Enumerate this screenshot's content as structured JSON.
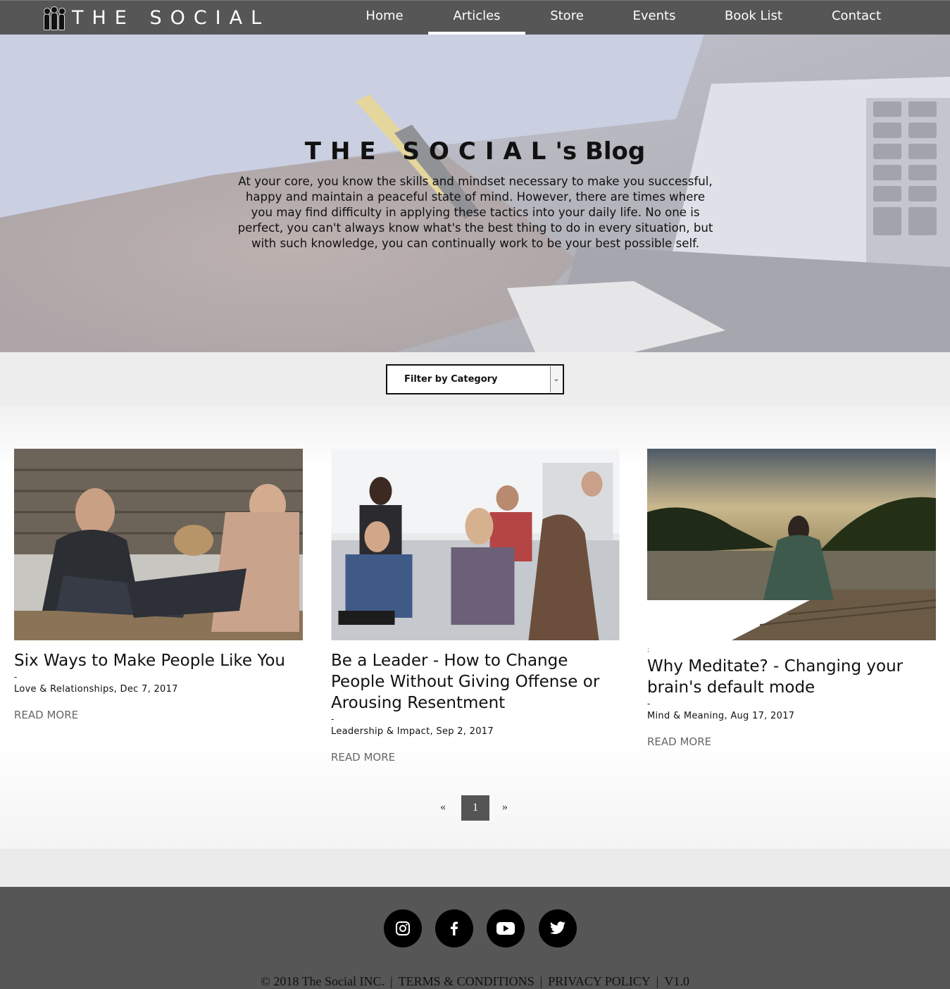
{
  "brand": {
    "name": "THE SOCIAL"
  },
  "nav": {
    "items": [
      {
        "label": "Home",
        "active": false
      },
      {
        "label": "Articles",
        "active": true
      },
      {
        "label": "Store",
        "active": false
      },
      {
        "label": "Events",
        "active": false
      },
      {
        "label": "Book List",
        "active": false
      },
      {
        "label": "Contact",
        "active": false
      }
    ]
  },
  "hero": {
    "title_brand": "THE SOCIAL",
    "title_suffix": "'s Blog",
    "text": "At your core, you know the skills and mindset necessary to make you successful, happy and maintain a peaceful state of mind. However, there are times where you may find difficulty in applying these tactics into your daily life. No one is perfect, you can't always know what's the best thing to do in every situation, but with such knowledge, you can continually work to be your best possible self."
  },
  "filter": {
    "label": "Filter by Category"
  },
  "posts": [
    {
      "title": "Six Ways to Make People Like You",
      "dash": "-",
      "category": "Love & Relationships",
      "date": "Dec 7, 2017",
      "read_more": "READ MORE",
      "marker": ""
    },
    {
      "title": "Be a Leader - How to Change People Without Giving Offense or Arousing Resentment",
      "dash": "-",
      "category": "Leadership & Impact",
      "date": "Sep 2, 2017",
      "read_more": "READ MORE",
      "marker": ""
    },
    {
      "title": "Why Meditate? - Changing your brain's default mode",
      "dash": "-",
      "category": "Mind & Meaning",
      "date": "Aug 17, 2017",
      "read_more": "READ MORE",
      "marker": ";"
    }
  ],
  "pagination": {
    "prev": "«",
    "current": "1",
    "next": "»"
  },
  "footer": {
    "social": [
      "instagram-icon",
      "facebook-icon",
      "youtube-icon",
      "twitter-icon"
    ],
    "copyright": "© 2018 The Social INC.",
    "terms": "TERMS & CONDITIONS",
    "privacy": "PRIVACY POLICY",
    "version": "V1.0",
    "separator": "|"
  }
}
